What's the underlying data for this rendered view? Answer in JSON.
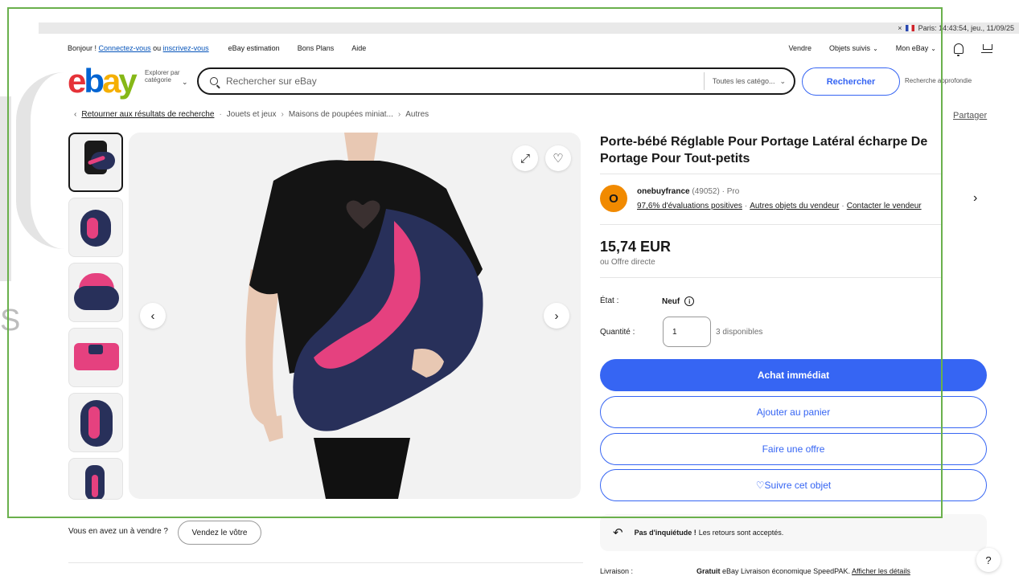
{
  "status": {
    "close": "×",
    "text": "Paris: 14:43:54, jeu., 11/09/25"
  },
  "watermark": {
    "text": "S"
  },
  "topnav": {
    "greeting": "Bonjour !",
    "signin": "Connectez-vous",
    "or": "ou",
    "register": "inscrivez-vous",
    "links": [
      "eBay estimation",
      "Bons Plans",
      "Aide"
    ],
    "sell": "Vendre",
    "watchlist": "Objets suivis",
    "myebay": "Mon eBay"
  },
  "logo": {
    "e": "e",
    "b": "b",
    "a": "a",
    "y": "y"
  },
  "explore": "Explorer par catégorie",
  "search": {
    "placeholder": "Rechercher sur eBay",
    "category": "Toutes les catégo...",
    "button": "Rechercher",
    "advanced": "Recherche approfondie"
  },
  "breadcrumb": {
    "back": "Retourner aux résultats de recherche",
    "items": [
      "Jouets et jeux",
      "Maisons de poupées miniat...",
      "Autres"
    ]
  },
  "share": "Partager",
  "product": {
    "title": "Porte-bébé Réglable Pour Portage Latéral écharpe De Portage Pour Tout-petits",
    "price": "15,74 EUR",
    "offer": "ou Offre directe",
    "state_label": "État :",
    "state_value": "Neuf",
    "qty_label": "Quantité :",
    "qty_value": "1",
    "qty_available": "3 disponibles"
  },
  "seller": {
    "initial": "O",
    "name": "onebuyfrance",
    "count": "(49052)",
    "type": "· Pro",
    "feedback": "97,6% d'évaluations positives",
    "other_items": "Autres objets du vendeur",
    "contact": "Contacter le vendeur"
  },
  "actions": {
    "buy_now": "Achat immédiat",
    "add_cart": "Ajouter au panier",
    "make_offer": "Faire une offre",
    "watch": "♡Suivre cet objet"
  },
  "returns": {
    "bold": "Pas d'inquiétude !",
    "text": "Les retours sont acceptés."
  },
  "delivery": {
    "label": "Livraison :",
    "free": "Gratuit",
    "service": "eBay Livraison économique SpeedPAK.",
    "details": "Afficher les détails"
  },
  "sell_prompt": {
    "question": "Vous en avez un à vendre ?",
    "button": "Vendez le vôtre"
  },
  "help": "?",
  "colors": {
    "accent": "#3665f3",
    "product_navy": "#28305a",
    "product_pink": "#e5417f",
    "frame": "#6ab04c"
  }
}
